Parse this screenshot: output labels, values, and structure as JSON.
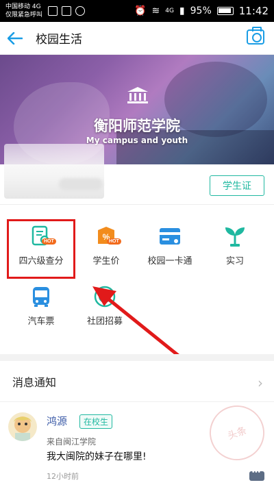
{
  "status_bar": {
    "carrier_line1": "中国移动 4G",
    "carrier_line2": "仅限紧急呼叫",
    "network": "4G",
    "battery": "95%",
    "time": "11:42"
  },
  "header": {
    "title": "校园生活"
  },
  "banner": {
    "school_name": "衡阳师范学院",
    "slogan": "My campus and youth"
  },
  "profile": {
    "student_card_label": "学生证"
  },
  "grid": {
    "items": [
      {
        "label": "四六级查分",
        "icon": "score-icon",
        "hot": "HOT",
        "color": "#1fb8a0"
      },
      {
        "label": "学生价",
        "icon": "discount-tag-icon",
        "hot": "HOT",
        "color": "#f28c1d"
      },
      {
        "label": "校园一卡通",
        "icon": "card-icon",
        "color": "#2a8fe0"
      },
      {
        "label": "实习",
        "icon": "sprout-icon",
        "color": "#1fb8a0"
      },
      {
        "label": "汽车票",
        "icon": "bus-icon",
        "color": "#2a8fe0"
      },
      {
        "label": "社团招募",
        "icon": "club-icon",
        "color": "#1fb8a0"
      }
    ]
  },
  "notifications": {
    "title": "消息通知",
    "message": {
      "name": "鸿源",
      "status": "在校生",
      "from": "来自闽江学院",
      "text": "我大闽院的妹子在哪里!",
      "time": "12小时前",
      "stamp": "头条"
    }
  }
}
